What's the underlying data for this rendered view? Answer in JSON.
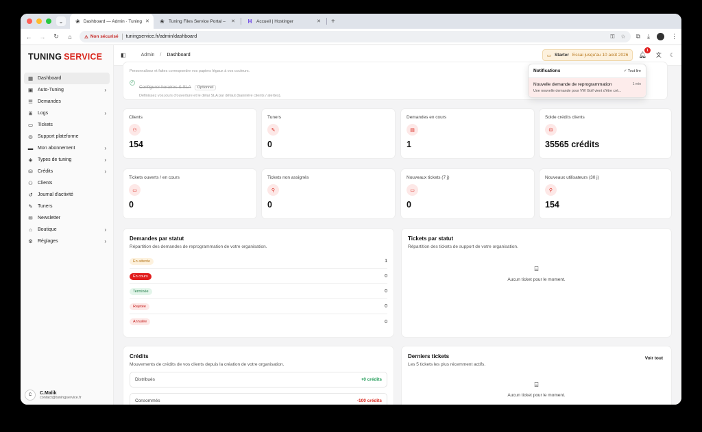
{
  "browser": {
    "tabs": [
      {
        "title": "Dashboard — Admin · Tuning"
      },
      {
        "title": "Tuning Files Service Portal –"
      },
      {
        "title": "Accueil | Hostinger"
      }
    ],
    "insecure_label": "Non sécurisé",
    "url": "tuningservice.fr/admin/dashboard"
  },
  "brand": {
    "part1": "TUNING",
    "part2": "SERVICE",
    "accent": "#d9261c"
  },
  "sidebar": {
    "items": [
      {
        "label": "Dashboard",
        "icon": "grid-icon"
      },
      {
        "label": "Auto-Tuning",
        "icon": "chip-icon"
      },
      {
        "label": "Demandes",
        "icon": "list-icon"
      },
      {
        "label": "Logs",
        "icon": "logs-icon"
      },
      {
        "label": "Tickets",
        "icon": "ticket-icon"
      },
      {
        "label": "Support plateforme",
        "icon": "support-icon"
      },
      {
        "label": "Mon abonnement",
        "icon": "card-icon"
      },
      {
        "label": "Types de tuning",
        "icon": "types-icon"
      },
      {
        "label": "Crédits",
        "icon": "credits-icon"
      },
      {
        "label": "Clients",
        "icon": "users-icon"
      },
      {
        "label": "Journal d'activité",
        "icon": "history-icon"
      },
      {
        "label": "Tuners",
        "icon": "wrench-icon"
      },
      {
        "label": "Newsletter",
        "icon": "mail-icon"
      },
      {
        "label": "Boutique",
        "icon": "shop-icon"
      },
      {
        "label": "Réglages",
        "icon": "gear-icon"
      }
    ]
  },
  "user": {
    "initial": "C",
    "name": "C.Malik",
    "email": "contact@tuningservice.fr"
  },
  "topbar": {
    "crumb_root": "Admin",
    "crumb_current": "Dashboard",
    "plan_name": "Starter",
    "plan_trial": "Essai jusqu'au 10 août 2026",
    "notif_count": "1"
  },
  "notifications": {
    "title": "Notifications",
    "mark_all": "Tout lire",
    "item_title": "Nouvelle demande de reprogrammation",
    "item_time": "1 min",
    "item_desc": "Une nouvelle demande pour VW Golf vient d'être cré..."
  },
  "setup": {
    "faded_text": "Personnalisez et faites correspondre vos papiers légaux à vos couleurs.",
    "step_title": "Configurer horaires & SLA",
    "step_optional": "Optionnel",
    "step_desc": "Définissez vos jours d'ouverture et le délai SLA par défaut (bannière clients / alertes)."
  },
  "stats": [
    {
      "label": "Clients",
      "value": "154",
      "icon": "users-icon"
    },
    {
      "label": "Tuners",
      "value": "0",
      "icon": "wrench-icon"
    },
    {
      "label": "Demandes en cours",
      "value": "1",
      "icon": "file-icon"
    },
    {
      "label": "Solde crédits clients",
      "value": "35565 crédits",
      "icon": "coins-icon"
    },
    {
      "label": "Tickets ouverts / en cours",
      "value": "0",
      "icon": "ticket-icon"
    },
    {
      "label": "Tickets non assignés",
      "value": "0",
      "icon": "user-plus-icon"
    },
    {
      "label": "Nouveaux tickets (7 j)",
      "value": "0",
      "icon": "ticket-icon"
    },
    {
      "label": "Nouveaux utilisateurs (30 j)",
      "value": "154",
      "icon": "user-plus-icon"
    }
  ],
  "status_panel": {
    "title": "Demandes par statut",
    "subtitle": "Répartition des demandes de reprogrammation de votre organisation.",
    "rows": [
      {
        "label": "En attente",
        "count": "1",
        "bg": "#fdf1dd",
        "fg": "#b7791f"
      },
      {
        "label": "En cours",
        "count": "0",
        "bg": "#e11d1d",
        "fg": "#ffffff"
      },
      {
        "label": "Terminée",
        "count": "0",
        "bg": "#e3f5ea",
        "fg": "#1d7a45"
      },
      {
        "label": "Rejetée",
        "count": "0",
        "bg": "#fde8e7",
        "fg": "#c5221f"
      },
      {
        "label": "Annulée",
        "count": "0",
        "bg": "#fde8e7",
        "fg": "#c5221f"
      }
    ]
  },
  "tickets_status_panel": {
    "title": "Tickets par statut",
    "subtitle": "Répartition des tickets de support de votre organisation.",
    "empty": "Aucun ticket pour le moment."
  },
  "credits_panel": {
    "title": "Crédits",
    "subtitle": "Mouvements de crédits de vos clients depuis la création de votre organisation.",
    "rows": [
      {
        "label": "Distribués",
        "value": "+0 crédits"
      },
      {
        "label": "Consommés",
        "value": "-100 crédits"
      }
    ]
  },
  "latest_tickets_panel": {
    "title": "Derniers tickets",
    "subtitle": "Les 5 tickets les plus récemment actifs.",
    "view_all": "Voir tout",
    "empty": "Aucun ticket pour le moment."
  }
}
